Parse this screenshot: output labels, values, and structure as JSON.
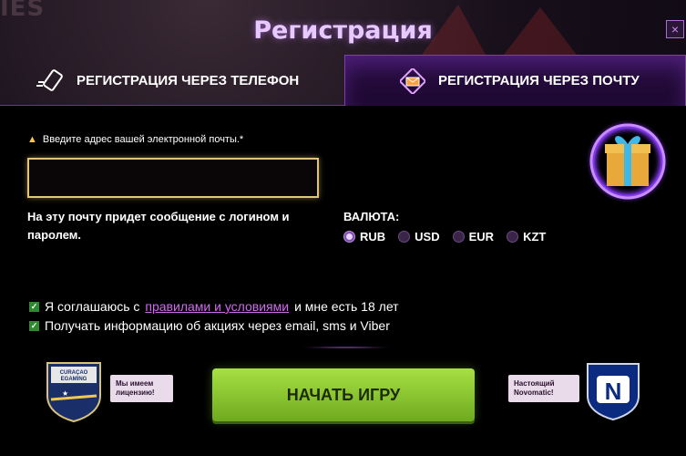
{
  "background": {
    "letters": "IES"
  },
  "title": "Регистрация",
  "close_icon": "×",
  "tabs": [
    {
      "label": "РЕГИСТРАЦИЯ ЧЕРЕЗ ТЕЛЕФОН",
      "icon": "phone-icon",
      "active": false
    },
    {
      "label": "РЕГИСТРАЦИЯ ЧЕРЕЗ ПОЧТУ",
      "icon": "envelope-icon",
      "active": true
    }
  ],
  "form": {
    "email_label": "Введите адрес вашей электронной почты.*",
    "email_value": "",
    "email_placeholder": "",
    "hint": "На эту почту придет сообщение с логином и паролем.",
    "currency_label": "ВАЛЮТА:",
    "currencies": [
      {
        "code": "RUB",
        "selected": true
      },
      {
        "code": "USD",
        "selected": false
      },
      {
        "code": "EUR",
        "selected": false
      },
      {
        "code": "KZT",
        "selected": false
      }
    ],
    "agree_prefix": "Я соглашаюсь с ",
    "agree_link": "правилами и условиями",
    "agree_suffix": " и мне есть 18 лет",
    "agree_checked": true,
    "promo": "Получать информацию об акциях через email, sms и Viber",
    "promo_checked": true
  },
  "cta_label": "НАЧАТЬ ИГРУ",
  "license_badge": {
    "text": "CURAÇAO EGAMING",
    "bubble": "Мы имеем лицензию!"
  },
  "novomatic_badge": {
    "bubble": "Настоящий Novomatic!",
    "letter": "N"
  },
  "colors": {
    "accent": "#a05ad0",
    "cta": "#8cc532",
    "title": "#e7c8ff",
    "link": "#d06cf0"
  }
}
